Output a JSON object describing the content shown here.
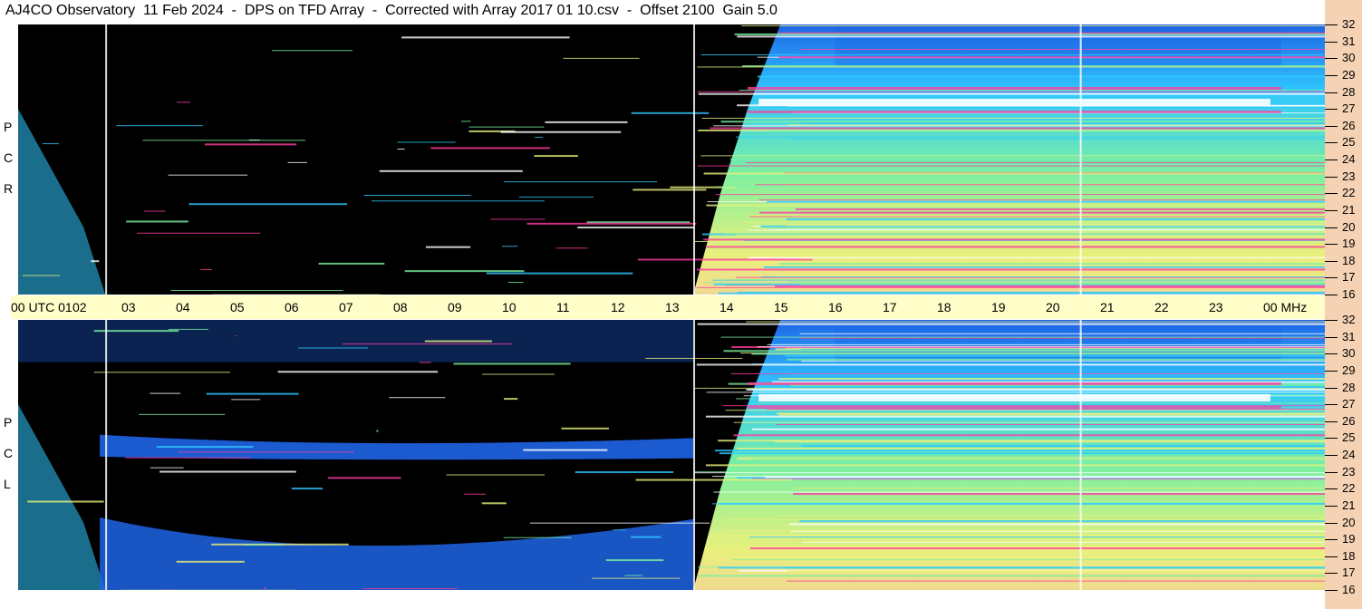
{
  "title": "AJ4CO Observatory  11 Feb 2024  -  DPS on TFD Array  -  Corrected with Array 2017 01 10.csv  -  Offset 2100  Gain 5.0",
  "panels": [
    {
      "label_letters": [
        "P",
        "C",
        "R"
      ]
    },
    {
      "label_letters": [
        "P",
        "C",
        "L"
      ]
    }
  ],
  "utc_labels": [
    "00  UTC  01",
    "02",
    "03",
    "04",
    "05",
    "06",
    "07",
    "08",
    "09",
    "10",
    "11",
    "12",
    "13",
    "14",
    "15",
    "16",
    "17",
    "18",
    "19",
    "20",
    "21",
    "22",
    "23",
    "00 MHz"
  ],
  "colors": {
    "background": "#000000",
    "band_blue": "#1e64e6",
    "cyan": "#30c8ff",
    "green": "#7cf0a0",
    "yellow": "#e8f07c",
    "magenta": "#ff3ca0",
    "white": "#ffffff",
    "axis_panel": "#f5d2b4",
    "utc_bar": "#fffdc8"
  },
  "chart_data": {
    "type": "heatmap",
    "x_axis": {
      "unit": "UTC hour",
      "range": [
        0,
        24
      ],
      "ticks": [
        "00",
        "01",
        "02",
        "03",
        "04",
        "05",
        "06",
        "07",
        "08",
        "09",
        "10",
        "11",
        "12",
        "13",
        "14",
        "15",
        "16",
        "17",
        "18",
        "19",
        "20",
        "21",
        "22",
        "23",
        "00"
      ]
    },
    "y_axis": {
      "unit": "MHz",
      "range": [
        16,
        32
      ],
      "ticks": [
        "16",
        "17",
        "18",
        "19",
        "20",
        "21",
        "22",
        "23",
        "24",
        "25",
        "26",
        "27",
        "28",
        "29",
        "30",
        "31",
        "32"
      ]
    },
    "panels": [
      "RCP",
      "LCP"
    ],
    "day_side_start_utc": 13.0,
    "night_low_activity_utc": [
      1.5,
      12.5
    ],
    "strong_band_mhz": 27.3,
    "vertical_lines_utc": [
      1.6,
      12.4,
      19.5
    ]
  }
}
